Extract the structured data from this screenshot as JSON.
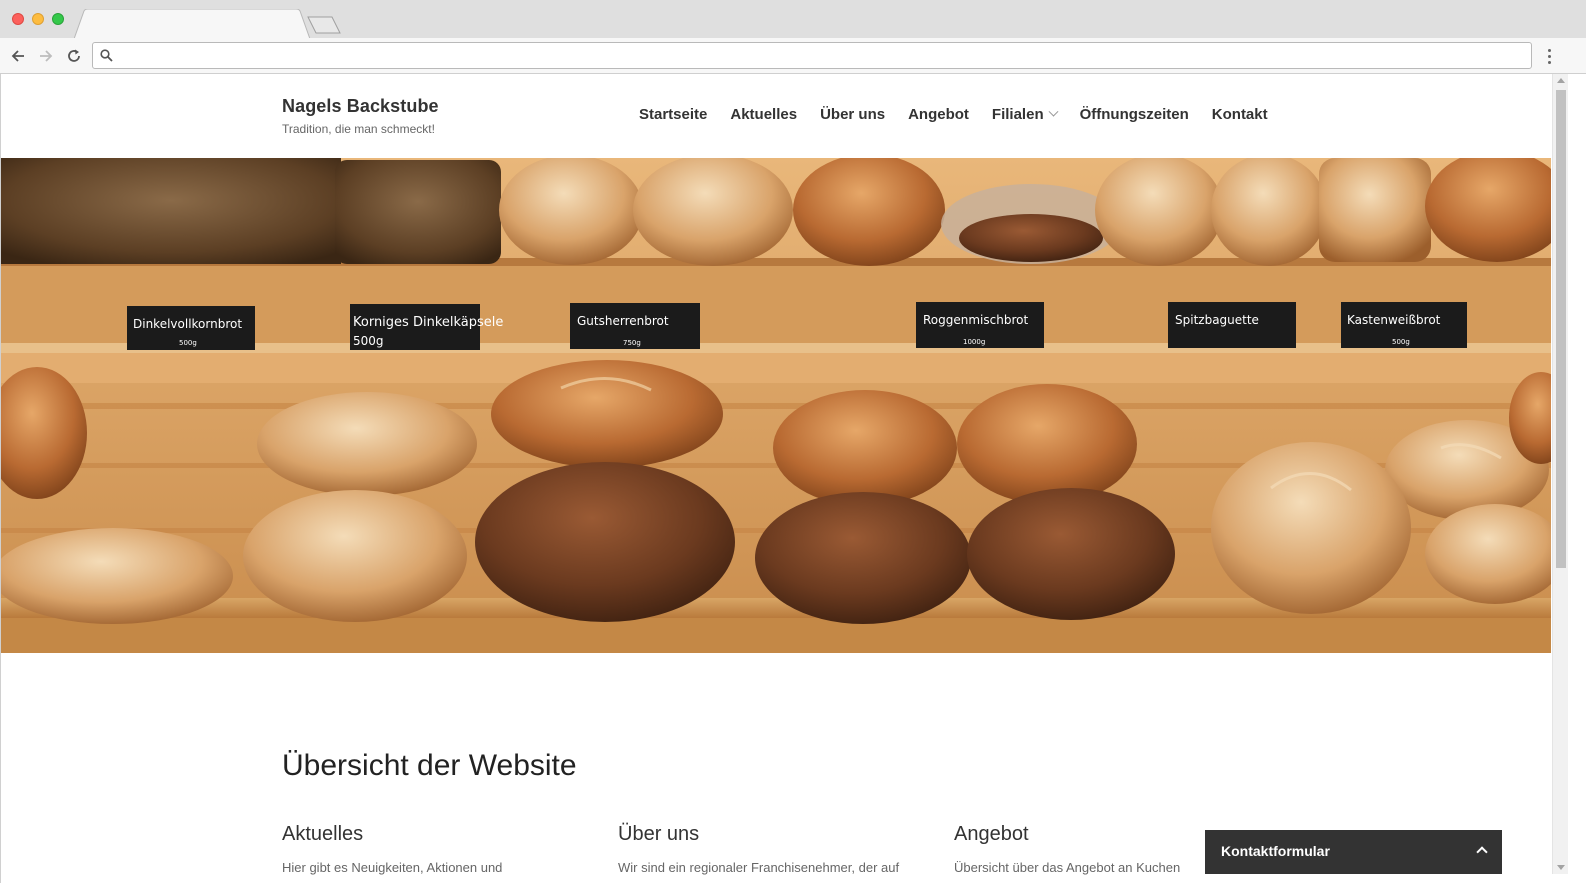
{
  "browser": {
    "tab_title": "",
    "url": "",
    "colors": {
      "chrome": "#dfdfdf",
      "toolbar": "#f7f7f7"
    }
  },
  "site": {
    "title": "Nagels Backstube",
    "tagline": "Tradition, die man schmeckt!"
  },
  "nav": {
    "items": [
      {
        "label": "Startseite"
      },
      {
        "label": "Aktuelles"
      },
      {
        "label": "Über uns"
      },
      {
        "label": "Angebot"
      },
      {
        "label": "Filialen",
        "has_submenu": true
      },
      {
        "label": "Öffnungszeiten"
      },
      {
        "label": "Kontakt"
      }
    ]
  },
  "hero": {
    "signs": [
      {
        "name": "Dinkelvollkornbrot",
        "weight": "500g"
      },
      {
        "name": "Korniges Dinkelkäpsele",
        "weight": "500g"
      },
      {
        "name": "Gutsherrenbrot",
        "weight": "750g"
      },
      {
        "name": "Roggenmischbrot",
        "weight": "1000g"
      },
      {
        "name": "Spitzbaguette",
        "weight": ""
      },
      {
        "name": "Kastenweißbrot",
        "weight": "500g"
      }
    ]
  },
  "overview": {
    "title": "Übersicht der Website",
    "columns": [
      {
        "heading": "Aktuelles",
        "text": "Hier gibt es Neuigkeiten, Aktionen und"
      },
      {
        "heading": "Über uns",
        "text": "Wir sind ein regionaler Franchisenehmer, der auf"
      },
      {
        "heading": "Angebot",
        "text": "Übersicht über das Angebot an Kuchen"
      }
    ]
  },
  "contact_widget": {
    "label": "Kontaktformular"
  },
  "icons": [
    "back-arrow-icon",
    "forward-arrow-icon",
    "reload-icon",
    "search-icon",
    "menu-dots-icon",
    "chevron-down-icon",
    "chevron-up-icon"
  ]
}
